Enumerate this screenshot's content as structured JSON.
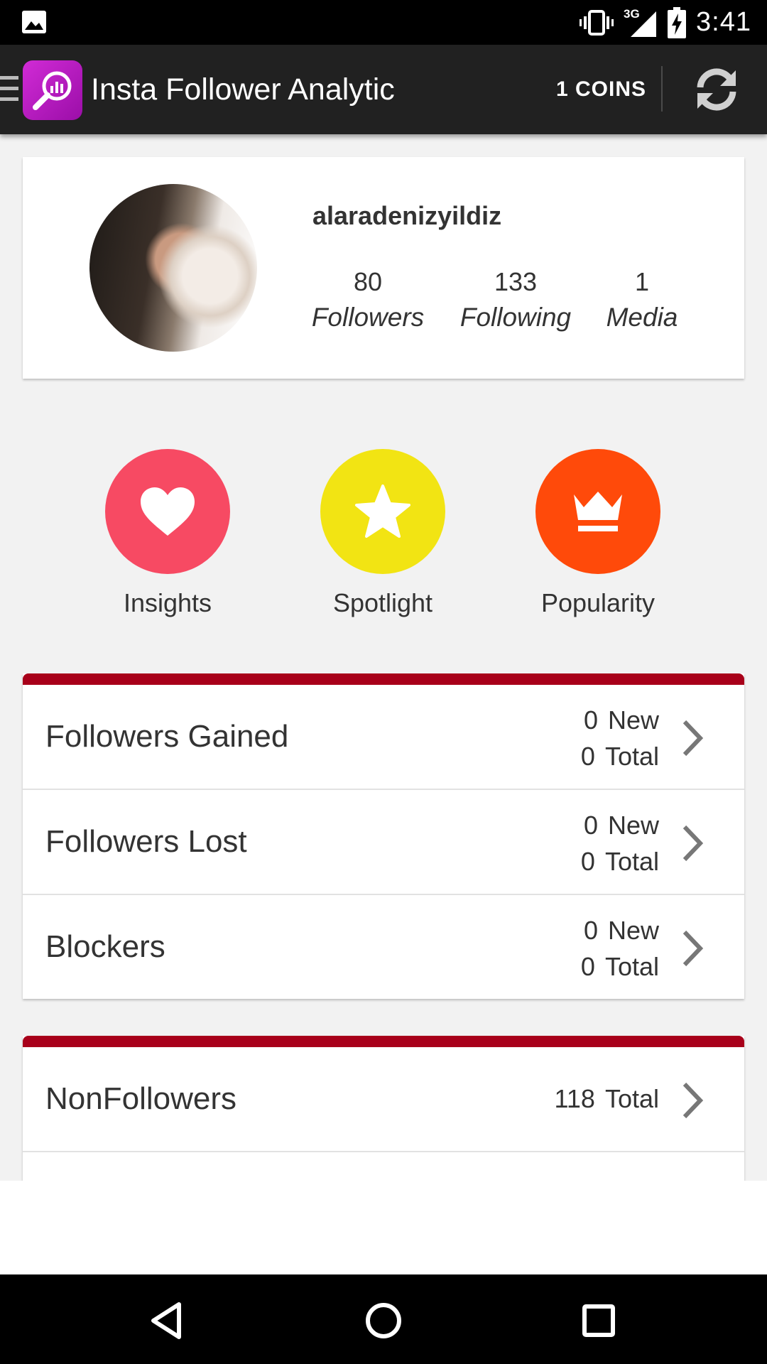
{
  "status_bar": {
    "time": "3:41",
    "network": "3G",
    "icons": [
      "image-notification-icon",
      "vibrate-icon",
      "signal-icon",
      "battery-charging-icon"
    ]
  },
  "action_bar": {
    "title": "Insta Follower Analytic",
    "coins": "1 COINS",
    "icons": [
      "nav-drawer-icon",
      "app-logo-icon",
      "refresh-icon"
    ]
  },
  "profile": {
    "username": "alaradenizyildiz",
    "stats": [
      {
        "value": "80",
        "label": "Followers"
      },
      {
        "value": "133",
        "label": "Following"
      },
      {
        "value": "1",
        "label": "Media"
      }
    ]
  },
  "actions": [
    {
      "label": "Insights",
      "icon": "heart-icon",
      "color": "#f74a63"
    },
    {
      "label": "Spotlight",
      "icon": "star-icon",
      "color": "#f2e413"
    },
    {
      "label": "Popularity",
      "icon": "crown-icon",
      "color": "#ff4a0a"
    }
  ],
  "section_followers": {
    "rows": [
      {
        "label": "Followers Gained",
        "new": "0",
        "new_label": "New",
        "total": "0",
        "total_label": "Total"
      },
      {
        "label": "Followers Lost",
        "new": "0",
        "new_label": "New",
        "total": "0",
        "total_label": "Total"
      },
      {
        "label": "Blockers",
        "new": "0",
        "new_label": "New",
        "total": "0",
        "total_label": "Total"
      }
    ]
  },
  "section_nonfollowers": {
    "rows": [
      {
        "label": "NonFollowers",
        "total": "118",
        "total_label": "Total"
      }
    ]
  },
  "colors": {
    "accent_bar": "#a8001a",
    "action_bar_bg": "#212121",
    "background": "#f2f2f2"
  },
  "nav_bar": {
    "icons": [
      "back-icon",
      "home-icon",
      "recents-icon"
    ]
  }
}
